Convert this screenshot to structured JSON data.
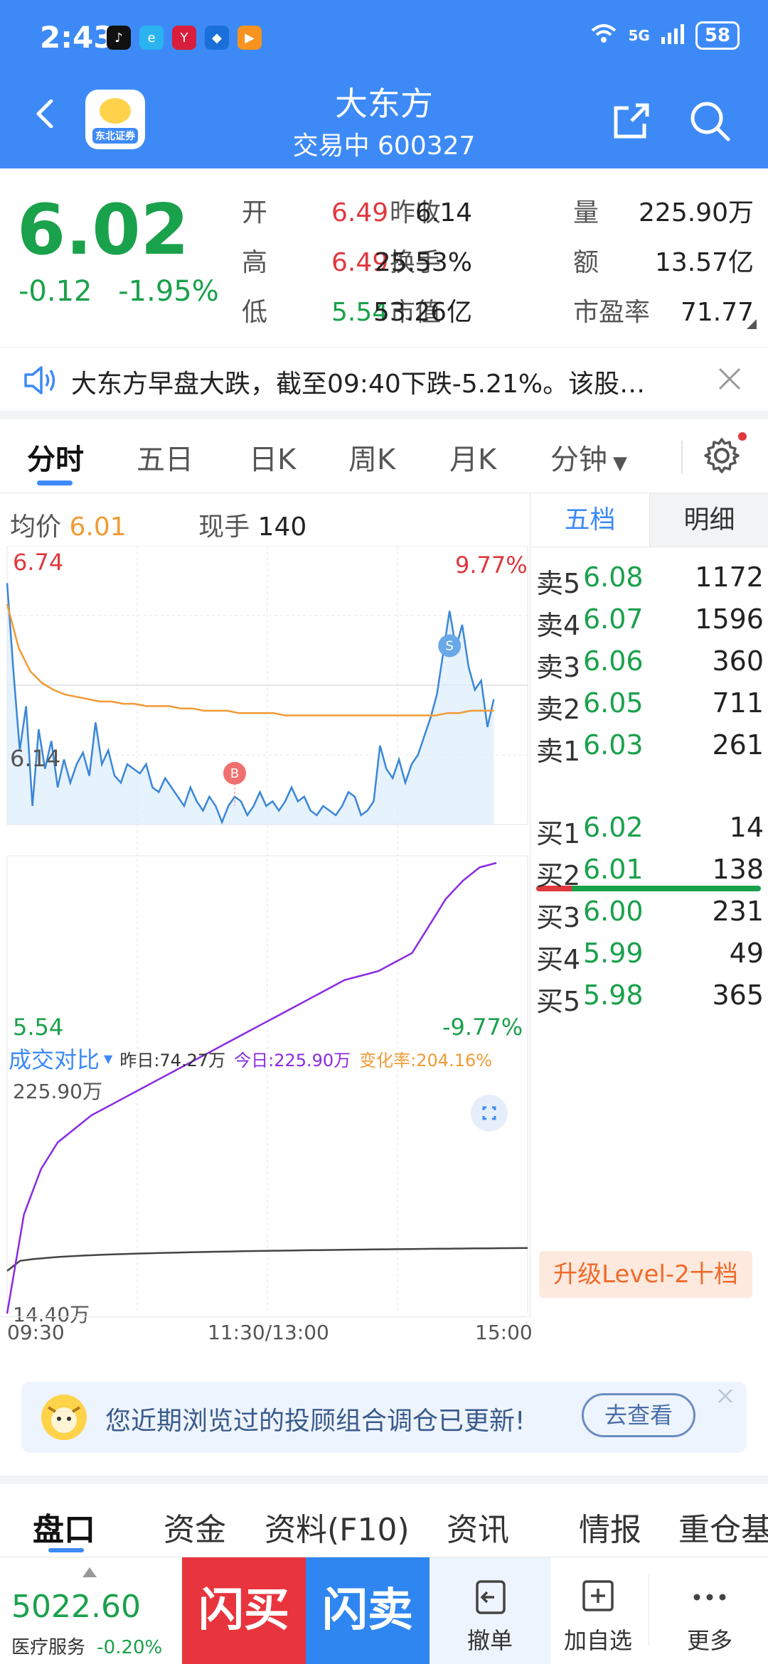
{
  "status": {
    "time": "2:43",
    "network": "5G",
    "battery": "58"
  },
  "header": {
    "title": "大东方",
    "subtitle": "交易中 600327",
    "app_logo_text": "东北证券"
  },
  "quote": {
    "price": "6.02",
    "change": "-0.12",
    "change_pct": "-1.95%",
    "rows": [
      {
        "l1": "开",
        "v1": "6.49",
        "l2": "昨收",
        "v2": "6.14",
        "l3": "量",
        "v3": "225.90万"
      },
      {
        "l1": "高",
        "v1": "6.49",
        "l2": "换手",
        "v2": "25.53%",
        "l3": "额",
        "v3": "13.57亿"
      },
      {
        "l1": "低",
        "v1": "5.54",
        "l2": "市值",
        "v2": "53.26亿",
        "l3": "市盈率",
        "v3": "71.77"
      }
    ]
  },
  "notice": {
    "text": "大东方早盘大跌，截至09:40下跌-5.21%。该股…"
  },
  "tabs": [
    "分时",
    "五日",
    "日K",
    "周K",
    "月K",
    "分钟"
  ],
  "chart_info": {
    "avg_label": "均价",
    "avg_value": "6.01",
    "hand_label": "现手",
    "hand_value": "140",
    "price_high": "6.74",
    "price_mid": "6.14",
    "price_low": "5.54",
    "pct_high": "9.77%",
    "pct_low": "-9.77%",
    "vol_title": "成交对比",
    "vol_yesterday": "昨日:74.27万",
    "vol_today": "今日:225.90万",
    "vol_change": "变化率:204.16%",
    "vol_top": "225.90万",
    "vol_bottom": "14.40万",
    "times": [
      "09:30",
      "11:30/13:00",
      "15:00"
    ],
    "marker_buy": "B",
    "marker_sell": "S"
  },
  "chart_data": {
    "type": "line",
    "x_range": [
      "09:30",
      "15:00"
    ],
    "ylim": [
      5.54,
      6.74
    ],
    "series": [
      {
        "name": "price",
        "color": "#3a86d8",
        "values": [
          6.58,
          6.2,
          5.86,
          6.05,
          5.62,
          5.95,
          5.78,
          5.9,
          5.7,
          5.82,
          5.72,
          5.8,
          5.85,
          5.75,
          5.98,
          5.8,
          5.86,
          5.75,
          5.72,
          5.8,
          5.78,
          5.76,
          5.8,
          5.7,
          5.68,
          5.74,
          5.7,
          5.66,
          5.62,
          5.7,
          5.64,
          5.6,
          5.66,
          5.62,
          5.55,
          5.62,
          5.66,
          5.64,
          5.58,
          5.62,
          5.68,
          5.62,
          5.64,
          5.6,
          5.64,
          5.7,
          5.64,
          5.66,
          5.6,
          5.58,
          5.62,
          5.6,
          5.58,
          5.62,
          5.68,
          5.66,
          5.58,
          5.6,
          5.64,
          5.88,
          5.78,
          5.74,
          5.82,
          5.72,
          5.8,
          5.84,
          5.92,
          6.0,
          6.1,
          6.28,
          6.46,
          6.3,
          6.4,
          6.22,
          6.12,
          6.16,
          5.96,
          6.08
        ]
      },
      {
        "name": "avg",
        "color": "#f29a35",
        "values": [
          6.49,
          6.3,
          6.2,
          6.15,
          6.12,
          6.1,
          6.09,
          6.08,
          6.07,
          6.07,
          6.06,
          6.06,
          6.05,
          6.05,
          6.05,
          6.04,
          6.04,
          6.03,
          6.03,
          6.03,
          6.02,
          6.02,
          6.02,
          6.02,
          6.01,
          6.01,
          6.01,
          6.01,
          6.01,
          6.01,
          6.01,
          6.01,
          6.01,
          6.01,
          6.01,
          6.01,
          6.01,
          6.01,
          6.02,
          6.02,
          6.03,
          6.03,
          6.03
        ]
      }
    ]
  },
  "book": {
    "tab_on": "五档",
    "tab_off": "明细",
    "sells": [
      {
        "l": "卖5",
        "p": "6.08",
        "v": "1172"
      },
      {
        "l": "卖4",
        "p": "6.07",
        "v": "1596"
      },
      {
        "l": "卖3",
        "p": "6.06",
        "v": "360"
      },
      {
        "l": "卖2",
        "p": "6.05",
        "v": "711"
      },
      {
        "l": "卖1",
        "p": "6.03",
        "v": "261"
      }
    ],
    "buys": [
      {
        "l": "买1",
        "p": "6.02",
        "v": "14"
      },
      {
        "l": "买2",
        "p": "6.01",
        "v": "138"
      },
      {
        "l": "买3",
        "p": "6.00",
        "v": "231"
      },
      {
        "l": "买4",
        "p": "5.99",
        "v": "49"
      },
      {
        "l": "买5",
        "p": "5.98",
        "v": "365"
      }
    ],
    "upgrade": "升级Level-2十档"
  },
  "banner": {
    "text": "您近期浏览过的投顾组合调仓已更新!",
    "button": "去查看"
  },
  "bottom_tabs": [
    "盘口",
    "资金",
    "资料(F10)",
    "资讯",
    "情报",
    "重仓基"
  ],
  "bottom_bar": {
    "index_value": "5022.60",
    "index_name": "医疗服务",
    "index_change": "-0.20%",
    "flash_buy": "闪买",
    "flash_sell": "闪卖",
    "cancel": "撤单",
    "add_watch": "加自选",
    "more": "更多"
  }
}
